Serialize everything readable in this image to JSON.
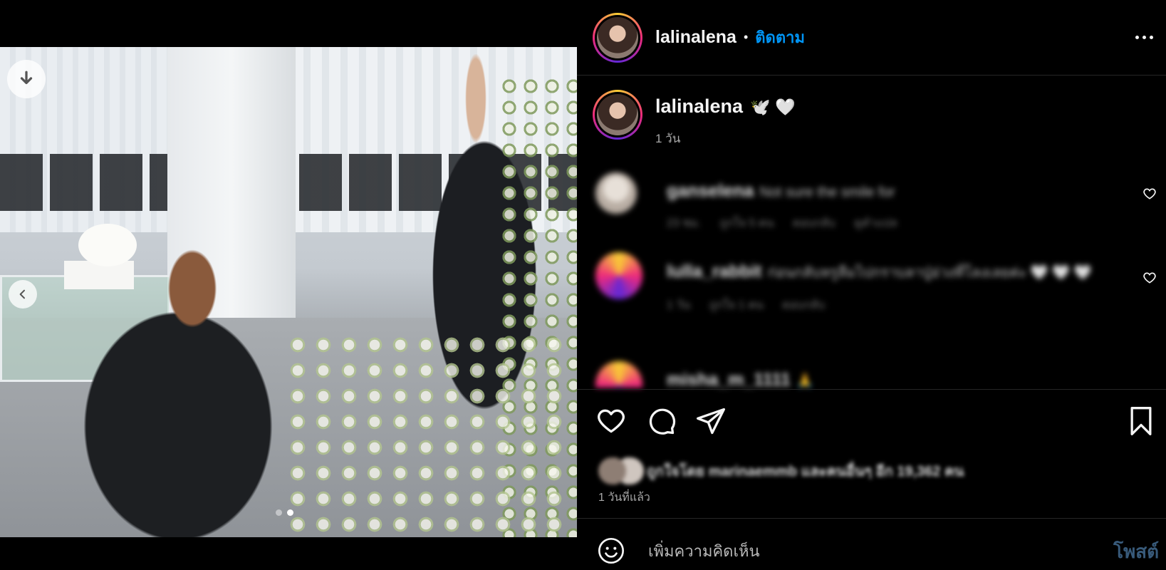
{
  "post": {
    "username": "lalinalena",
    "follow_label": "ติดตาม",
    "separator": "•",
    "caption_emoji": "🕊️ 🤍",
    "caption_time": "1 วัน",
    "media": {
      "slide_count": 2,
      "active_slide": 2
    }
  },
  "comments": [
    {
      "user": "ganselena",
      "text": "Not sure the smile for",
      "meta": [
        "23 ชม.",
        "ถูกใจ 5 คน",
        "ตอบกลับ",
        "ดูคำแปล"
      ]
    },
    {
      "user": "lulla_rabbit",
      "text": "ก่อนกลับหรูลืมไปกราบลาปู่อ่วงที่โลงเลยค่ะ 🤍 🤍 🤍",
      "meta": [
        "1 วัน",
        "ถูกใจ 1 คน",
        "ตอบกลับ"
      ]
    },
    {
      "user": "misha_m_1111",
      "text": "🙏",
      "meta": []
    }
  ],
  "likes": {
    "text": "ถูกใจโดย marinaemmb และคนอื่นๆ อีก 19,362 คน"
  },
  "post_date": "1 วันที่แล้ว",
  "composer": {
    "placeholder": "เพิ่มความคิดเห็น",
    "post_label": "โพสต์"
  },
  "colors": {
    "accent_blue": "#0095f6",
    "post_disabled": "#385a7a",
    "background": "#000000"
  },
  "icons": [
    "download-icon",
    "chevron-left-icon",
    "more-icon",
    "heart-icon",
    "comment-icon",
    "share-icon",
    "bookmark-icon",
    "emoji-icon"
  ]
}
